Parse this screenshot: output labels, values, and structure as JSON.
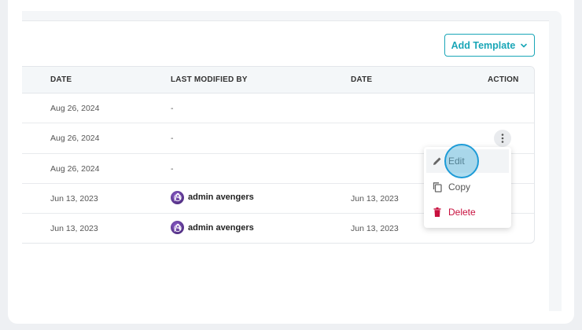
{
  "toolbar": {
    "add_template_label": "Add Template"
  },
  "table": {
    "headers": {
      "date": "DATE",
      "last_modified_by": "LAST MODIFIED BY",
      "date2": "DATE",
      "action": "ACTION"
    },
    "rows": [
      {
        "date": "Aug 26, 2024",
        "modified_by": "-",
        "modified_date": ""
      },
      {
        "date": "Aug 26, 2024",
        "modified_by": "-",
        "modified_date": ""
      },
      {
        "date": "Aug 26, 2024",
        "modified_by": "-",
        "modified_date": ""
      },
      {
        "date": "Jun 13, 2023",
        "modified_by": "admin avengers",
        "modified_date": "Jun 13, 2023"
      },
      {
        "date": "Jun 13, 2023",
        "modified_by": "admin avengers",
        "modified_date": "Jun 13, 2023"
      }
    ]
  },
  "action_menu": {
    "edit": "Edit",
    "copy": "Copy",
    "delete": "Delete"
  },
  "colors": {
    "accent": "#1aa6b7",
    "danger": "#c8103e"
  }
}
